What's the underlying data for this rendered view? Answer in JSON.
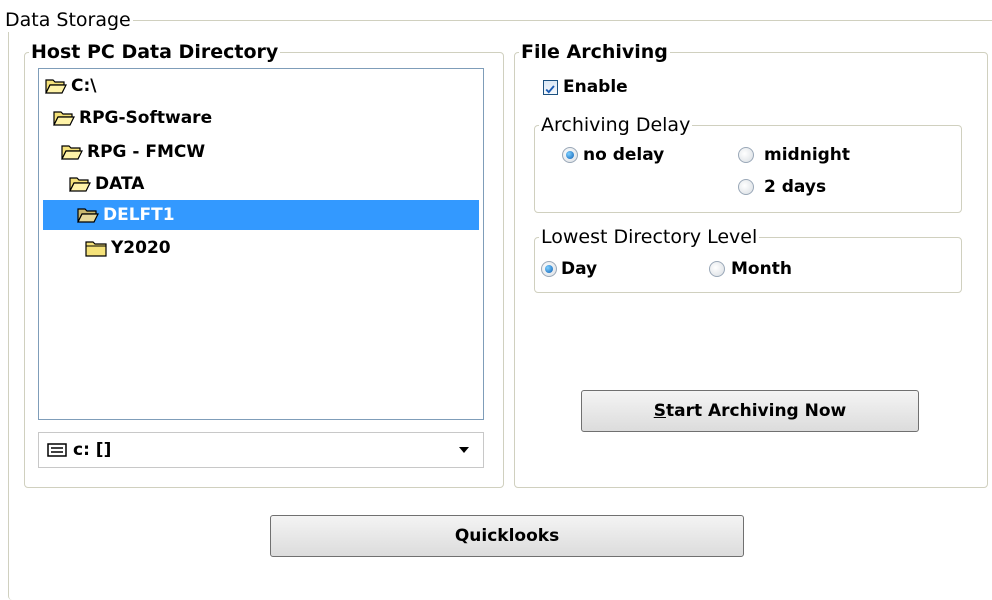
{
  "data_storage": {
    "title": "Data Storage",
    "host_pc": {
      "title": "Host PC Data Directory",
      "tree": [
        {
          "label": "C:\\",
          "icon": "open-folder-icon"
        },
        {
          "label": "RPG-Software",
          "icon": "open-folder-icon"
        },
        {
          "label": "RPG - FMCW",
          "icon": "open-folder-icon"
        },
        {
          "label": "DATA",
          "icon": "open-folder-icon"
        },
        {
          "label": "DELFT1",
          "icon": "open-folder-icon",
          "selected": true
        },
        {
          "label": "Y2020",
          "icon": "closed-folder-icon"
        }
      ],
      "drive": {
        "value": "c: []",
        "icon": "drive-icon"
      }
    },
    "file_archiving": {
      "title": "File Archiving",
      "enable_label": "Enable",
      "enable_checked": true,
      "delay": {
        "title": "Archiving Delay",
        "options": [
          "no delay",
          "midnight",
          "2 days"
        ],
        "selected": "no delay"
      },
      "lowest_level": {
        "title": "Lowest Directory Level",
        "options": [
          "Day",
          "Month"
        ],
        "selected": "Day"
      },
      "start_button": {
        "first_letter": "S",
        "rest": "tart Archiving Now"
      }
    },
    "quicklooks_label": "Quicklooks"
  },
  "colors": {
    "selection": "#3399ff",
    "folder": "#f5e27a"
  }
}
